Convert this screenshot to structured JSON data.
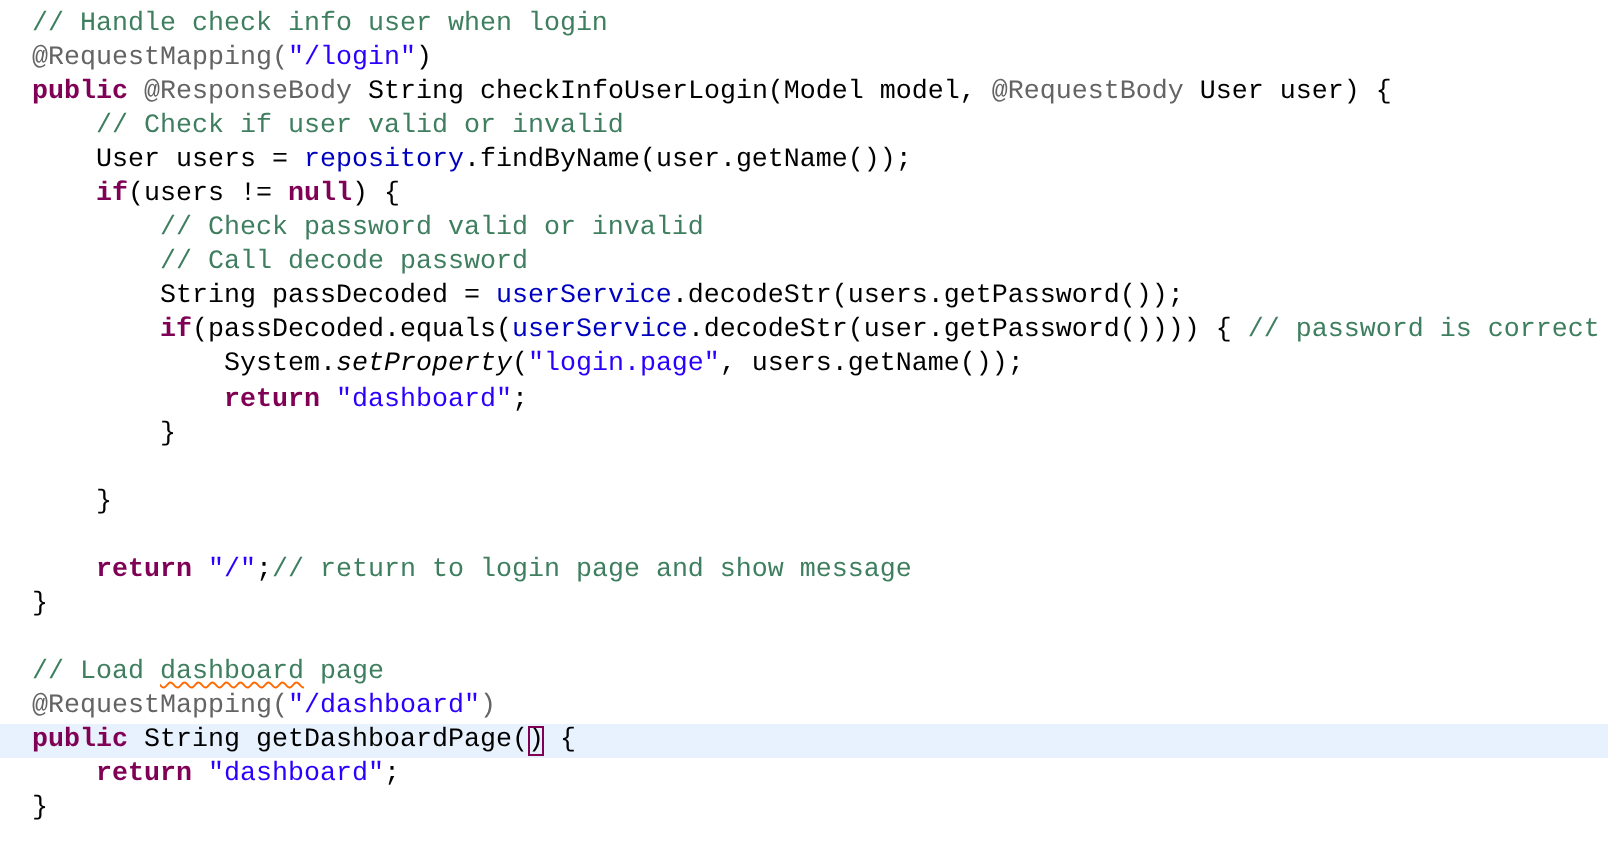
{
  "editor": {
    "lines": [
      {
        "kind": "code",
        "current": false,
        "tokens": [
          {
            "kind": "comment",
            "text": "// Handle check info user when login"
          }
        ]
      },
      {
        "kind": "code",
        "current": false,
        "tokens": [
          {
            "kind": "annotation",
            "text": "@RequestMapping("
          },
          {
            "kind": "string",
            "text": "\"/login\""
          },
          {
            "kind": "plain",
            "text": ")"
          }
        ]
      },
      {
        "kind": "code",
        "current": false,
        "tokens": [
          {
            "kind": "keyword",
            "text": "public"
          },
          {
            "kind": "annotation",
            "text": " @ResponseBody"
          },
          {
            "kind": "plain",
            "text": " String checkInfoUserLogin(Model model, "
          },
          {
            "kind": "annotation",
            "text": "@RequestBody"
          },
          {
            "kind": "plain",
            "text": " User user) {"
          }
        ]
      },
      {
        "kind": "code",
        "current": false,
        "tokens": [
          {
            "kind": "comment",
            "text": "    // Check if user valid or invalid"
          }
        ]
      },
      {
        "kind": "code",
        "current": false,
        "tokens": [
          {
            "kind": "plain",
            "text": "    User users = "
          },
          {
            "kind": "field",
            "text": "repository"
          },
          {
            "kind": "plain",
            "text": ".findByName(user.getName());"
          }
        ]
      },
      {
        "kind": "code",
        "current": false,
        "tokens": [
          {
            "kind": "keyword",
            "text": "    if"
          },
          {
            "kind": "plain",
            "text": "(users != "
          },
          {
            "kind": "keyword",
            "text": "null"
          },
          {
            "kind": "plain",
            "text": ") {"
          }
        ]
      },
      {
        "kind": "code",
        "current": false,
        "tokens": [
          {
            "kind": "comment",
            "text": "        // Check password valid or invalid"
          }
        ]
      },
      {
        "kind": "code",
        "current": false,
        "tokens": [
          {
            "kind": "comment",
            "text": "        // Call decode password"
          }
        ]
      },
      {
        "kind": "code",
        "current": false,
        "tokens": [
          {
            "kind": "plain",
            "text": "        String passDecoded = "
          },
          {
            "kind": "field",
            "text": "userService"
          },
          {
            "kind": "plain",
            "text": ".decodeStr(users.getPassword());"
          }
        ]
      },
      {
        "kind": "code",
        "current": false,
        "tokens": [
          {
            "kind": "keyword",
            "text": "        if"
          },
          {
            "kind": "plain",
            "text": "(passDecoded.equals("
          },
          {
            "kind": "field",
            "text": "userService"
          },
          {
            "kind": "plain",
            "text": ".decodeStr(user.getPassword()))) { "
          },
          {
            "kind": "comment",
            "text": "// password is correct"
          }
        ]
      },
      {
        "kind": "code",
        "current": false,
        "tokens": [
          {
            "kind": "plain",
            "text": "            System."
          },
          {
            "kind": "static",
            "text": "setProperty"
          },
          {
            "kind": "plain",
            "text": "("
          },
          {
            "kind": "string",
            "text": "\"login.page\""
          },
          {
            "kind": "plain",
            "text": ", users.getName());"
          }
        ]
      },
      {
        "kind": "code",
        "current": false,
        "tokens": [
          {
            "kind": "keyword",
            "text": "            return"
          },
          {
            "kind": "string",
            "text": " \"dashboard\""
          },
          {
            "kind": "plain",
            "text": ";"
          }
        ]
      },
      {
        "kind": "code",
        "current": false,
        "tokens": [
          {
            "kind": "plain",
            "text": "        }"
          }
        ]
      },
      {
        "kind": "blank"
      },
      {
        "kind": "code",
        "current": false,
        "tokens": [
          {
            "kind": "plain",
            "text": "    }"
          }
        ]
      },
      {
        "kind": "blank"
      },
      {
        "kind": "code",
        "current": false,
        "tokens": [
          {
            "kind": "keyword",
            "text": "    return"
          },
          {
            "kind": "string",
            "text": " \"/\""
          },
          {
            "kind": "plain",
            "text": ";"
          },
          {
            "kind": "comment",
            "text": "// return to login page and show message"
          }
        ]
      },
      {
        "kind": "code",
        "current": false,
        "tokens": [
          {
            "kind": "plain",
            "text": "}"
          }
        ]
      },
      {
        "kind": "blank"
      },
      {
        "kind": "code",
        "current": false,
        "tokens": [
          {
            "kind": "comment",
            "text": "// Load "
          },
          {
            "kind": "misspelled",
            "text": "dashboard"
          },
          {
            "kind": "comment",
            "text": " page"
          }
        ]
      },
      {
        "kind": "code",
        "current": false,
        "tokens": [
          {
            "kind": "annotation",
            "text": "@RequestMapping("
          },
          {
            "kind": "string",
            "text": "\"/dashboard\""
          },
          {
            "kind": "annotation",
            "text": ")"
          }
        ]
      },
      {
        "kind": "code",
        "current": true,
        "tokens": [
          {
            "kind": "keyword",
            "text": "public"
          },
          {
            "kind": "plain",
            "text": " String getDashboardPage("
          },
          {
            "kind": "bracket-match",
            "text": ")"
          },
          {
            "kind": "plain",
            "text": " {"
          }
        ]
      },
      {
        "kind": "code",
        "current": false,
        "tokens": [
          {
            "kind": "keyword",
            "text": "    return"
          },
          {
            "kind": "string",
            "text": " \"dashboard\""
          },
          {
            "kind": "plain",
            "text": ";"
          }
        ]
      },
      {
        "kind": "code",
        "current": false,
        "tokens": [
          {
            "kind": "plain",
            "text": "}"
          }
        ]
      }
    ]
  }
}
